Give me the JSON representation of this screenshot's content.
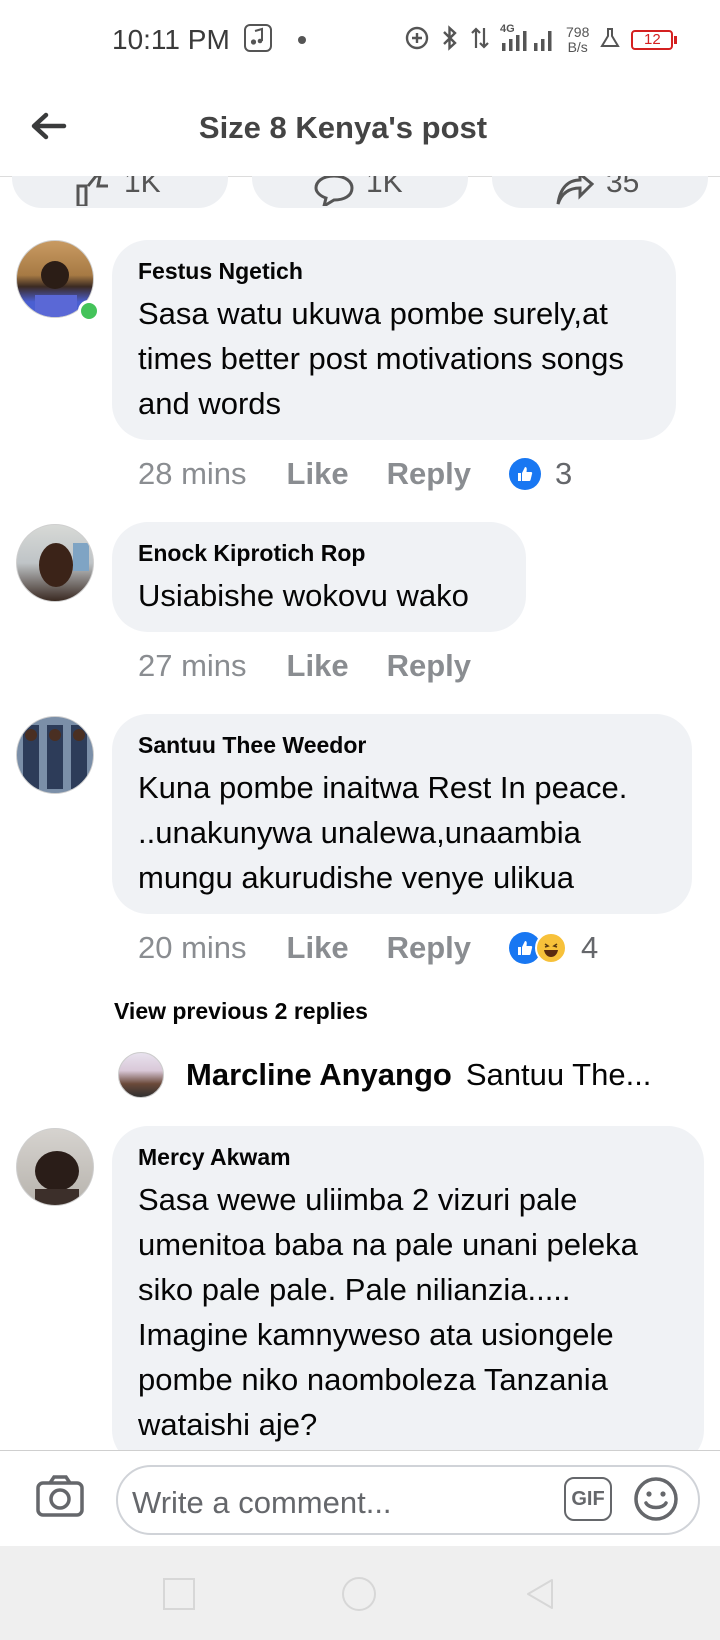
{
  "status_bar": {
    "time": "10:11 PM",
    "network": "4G",
    "speed_value": "798",
    "speed_unit": "B/s",
    "battery": "12",
    "icons": [
      "music-icon",
      "dot-icon",
      "data-saver-icon",
      "bluetooth-icon",
      "data-arrows-icon",
      "signal-icon",
      "flask-icon",
      "battery-icon"
    ]
  },
  "header": {
    "title": "Size 8 Kenya's post",
    "back_icon": "arrow-left-icon"
  },
  "reaction_pills": {
    "like_count": "1K",
    "comment_count": "1K",
    "share_count": "35"
  },
  "comments": [
    {
      "name": "Festus Ngetich",
      "text": "Sasa watu ukuwa pombe surely,at times better post motivations songs and words",
      "time": "28 mins",
      "like_label": "Like",
      "reply_label": "Reply",
      "reaction_count": "3",
      "online": true
    },
    {
      "name": "Enock Kiprotich Rop",
      "text": "Usiabishe wokovu wako",
      "time": "27 mins",
      "like_label": "Like",
      "reply_label": "Reply"
    },
    {
      "name": "Santuu Thee Weedor",
      "text": "Kuna pombe inaitwa Rest In peace. ..unakunywa unalewa,unaambia mungu akurudishe venye ulikua",
      "time": "20 mins",
      "like_label": "Like",
      "reply_label": "Reply",
      "reaction_count": "4"
    },
    {
      "name": "Mercy Akwam",
      "text": "Sasa wewe uliimba 2 vizuri pale umenitoa baba na pale unani peleka siko pale pale. Pale nilianzia..... Imagine  kamnyweso ata usiongele pombe niko naomboleza Tanzania wataishi aje?"
    }
  ],
  "view_previous": "View previous 2 replies",
  "reply_preview": {
    "name": "Marcline Anyango",
    "text": "Santuu The..."
  },
  "compose": {
    "placeholder": "Write a comment...",
    "gif_label": "GIF"
  },
  "colors": {
    "accent": "#1877f2",
    "bubble": "#f0f2f5",
    "muted": "#8a8d91",
    "online": "#44c35a",
    "battery_low": "#d42020"
  }
}
